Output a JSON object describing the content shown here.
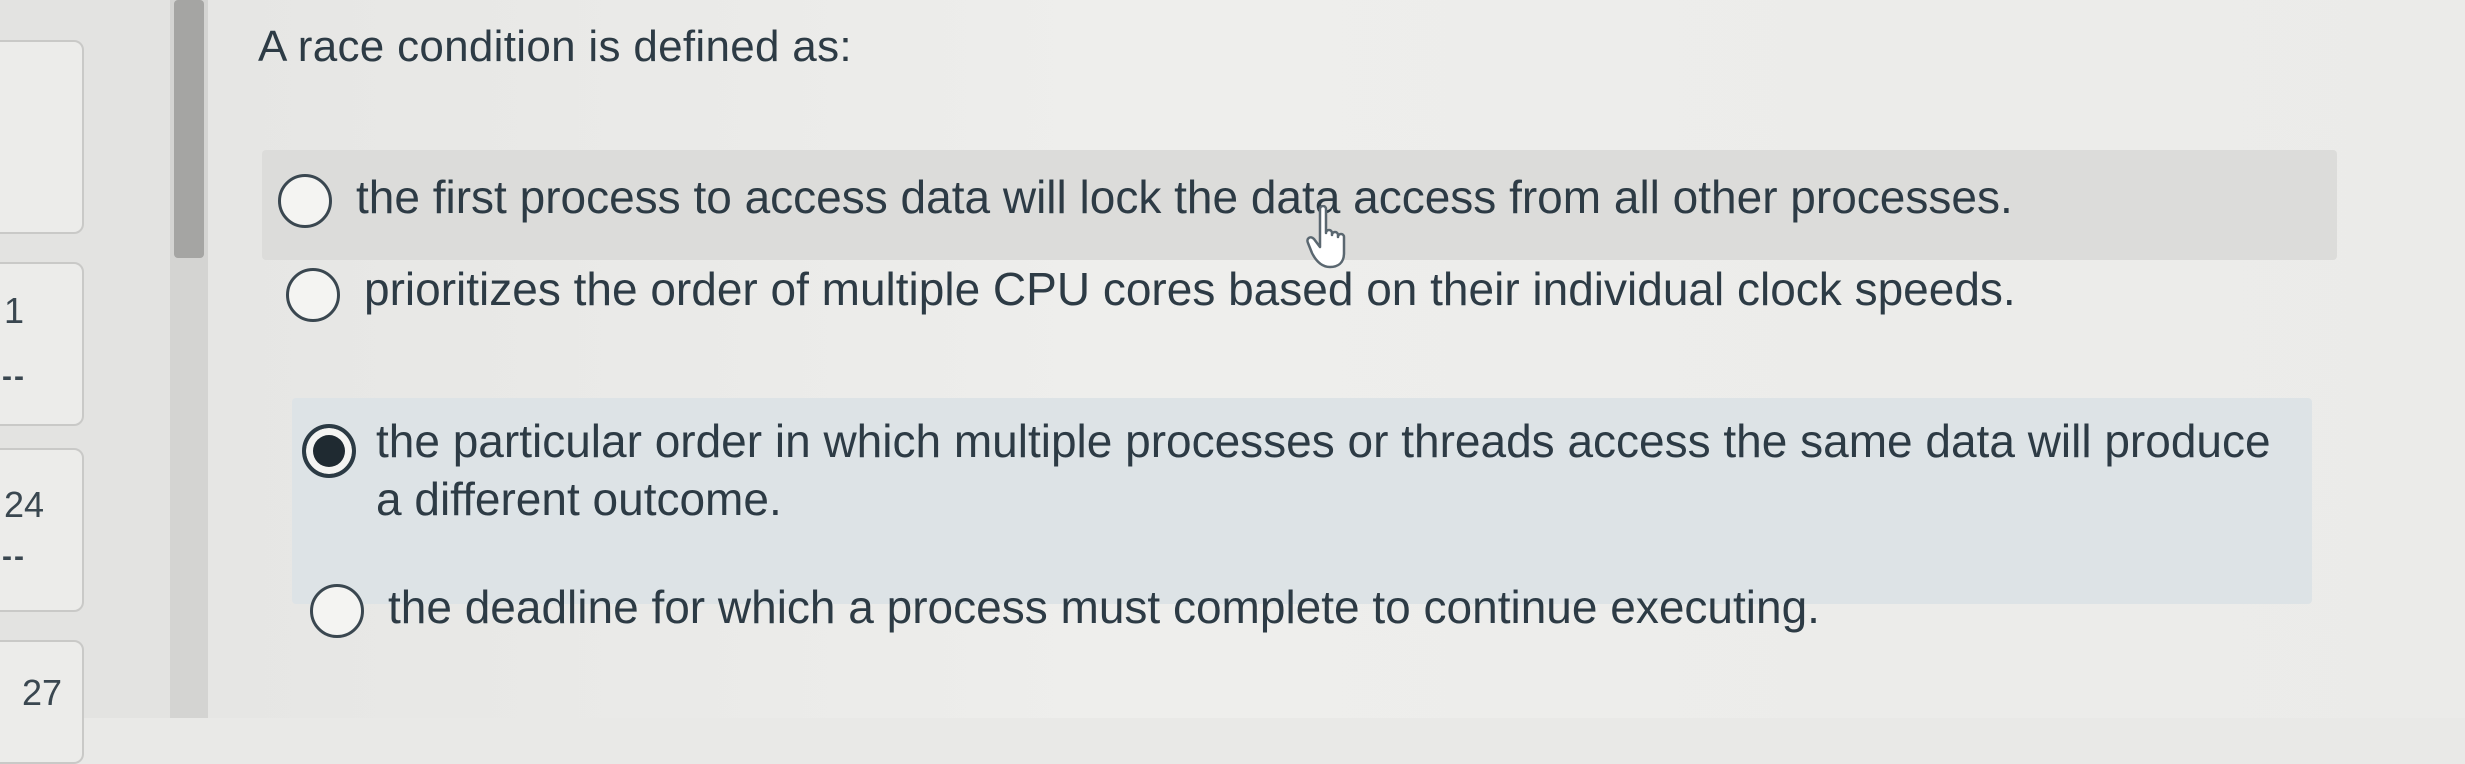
{
  "sidebar": {
    "numbers": [
      "1",
      "24",
      "27"
    ],
    "dashes": [
      "--",
      "--"
    ]
  },
  "question": {
    "text": "A race condition is defined as:"
  },
  "answers": [
    {
      "text": "the first process to access data will lock the data access from all other processes.",
      "selected": false
    },
    {
      "text": "prioritizes the order of multiple CPU cores based on their individual clock speeds.",
      "selected": false
    },
    {
      "text": "the particular order in which multiple processes or threads access the same data will produce a different outcome.",
      "selected": true
    },
    {
      "text": "the deadline for which a process must complete to continue executing.",
      "selected": false
    }
  ],
  "colors": {
    "text": "#2d3b45",
    "hover_bg": "#dcdcda",
    "selected_bg": "#dde3e6"
  },
  "icons": [
    "radio-button-icon",
    "hand-pointer-cursor-icon"
  ]
}
